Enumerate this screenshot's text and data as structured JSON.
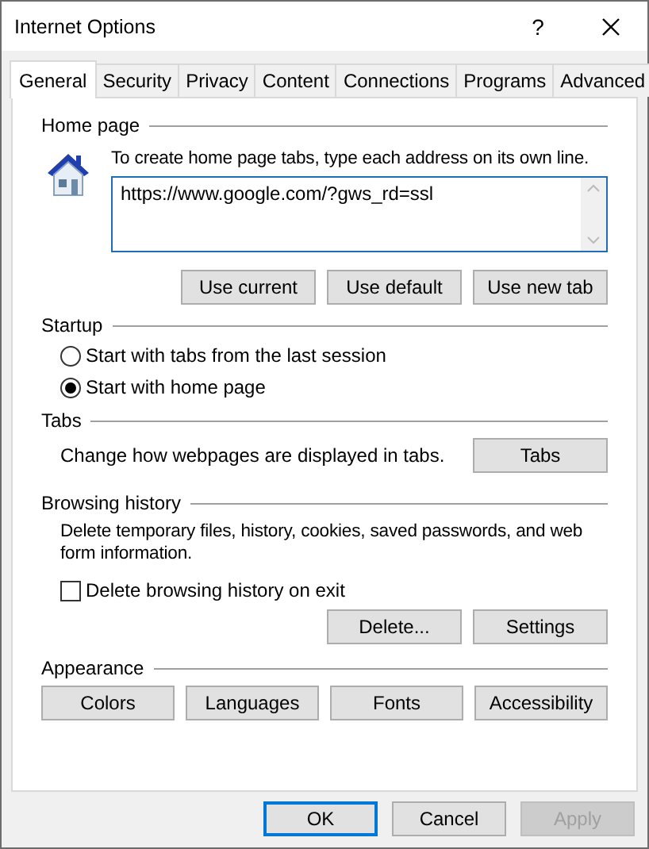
{
  "window": {
    "title": "Internet Options",
    "help": "?"
  },
  "tabs": [
    {
      "label": "General",
      "selected": true
    },
    {
      "label": "Security",
      "selected": false
    },
    {
      "label": "Privacy",
      "selected": false
    },
    {
      "label": "Content",
      "selected": false
    },
    {
      "label": "Connections",
      "selected": false
    },
    {
      "label": "Programs",
      "selected": false
    },
    {
      "label": "Advanced",
      "selected": false
    }
  ],
  "home_page": {
    "heading": "Home page",
    "description": "To create home page tabs, type each address on its own line.",
    "url": "https://www.google.com/?gws_rd=ssl",
    "buttons": [
      "Use current",
      "Use default",
      "Use new tab"
    ]
  },
  "startup": {
    "heading": "Startup",
    "options": [
      {
        "label": "Start with tabs from the last session",
        "selected": false
      },
      {
        "label": "Start with home page",
        "selected": true
      }
    ]
  },
  "tabs_section": {
    "heading": "Tabs",
    "description": "Change how webpages are displayed in tabs.",
    "button": "Tabs"
  },
  "browsing_history": {
    "heading": "Browsing history",
    "description": "Delete temporary files, history, cookies, saved passwords, and web form information.",
    "delete_on_exit": {
      "label": "Delete browsing history on exit",
      "checked": false
    },
    "buttons": [
      "Delete...",
      "Settings"
    ]
  },
  "appearance": {
    "heading": "Appearance",
    "buttons": [
      "Colors",
      "Languages",
      "Fonts",
      "Accessibility"
    ]
  },
  "footer_buttons": [
    {
      "label": "OK",
      "default": true,
      "disabled": false
    },
    {
      "label": "Cancel",
      "default": false,
      "disabled": false
    },
    {
      "label": "Apply",
      "default": false,
      "disabled": true
    }
  ]
}
